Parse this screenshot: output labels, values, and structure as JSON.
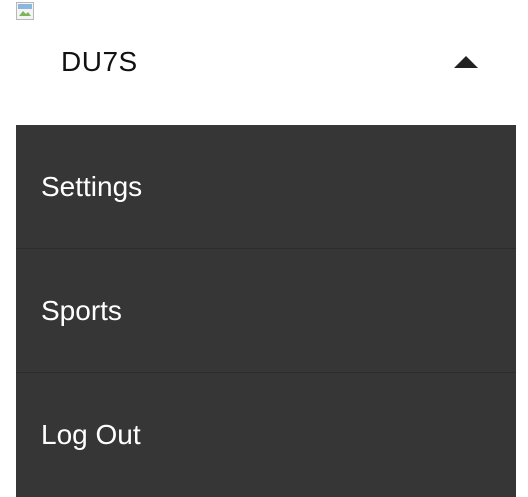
{
  "header": {
    "username": "DU7S",
    "toggle_icon": "caret-up-icon"
  },
  "avatar": {
    "icon": "broken-image-icon"
  },
  "menu": {
    "items": [
      {
        "label": "Settings"
      },
      {
        "label": "Sports"
      },
      {
        "label": "Log Out"
      }
    ]
  },
  "colors": {
    "menu_background": "#363636",
    "menu_text": "#ffffff",
    "header_text": "#111111"
  }
}
